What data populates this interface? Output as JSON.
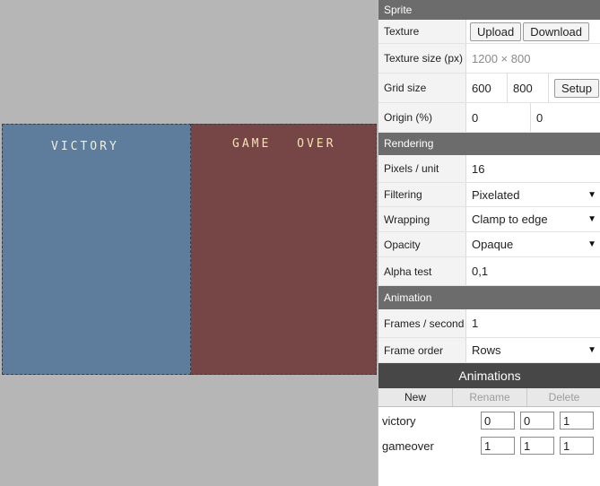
{
  "canvas": {
    "cells": [
      {
        "label": "VICTORY",
        "color": "#5e7c9c"
      },
      {
        "label": "GAME OVER",
        "color": "#764646"
      }
    ]
  },
  "sprite": {
    "header": "Sprite",
    "texture_label": "Texture",
    "upload_label": "Upload",
    "download_label": "Download",
    "texture_size_label": "Texture size (px)",
    "texture_size_value": "1200 × 800",
    "grid_size_label": "Grid size",
    "grid_w": "600",
    "grid_h": "800",
    "setup_label": "Setup",
    "origin_label": "Origin (%)",
    "origin_x": "0",
    "origin_y": "0"
  },
  "rendering": {
    "header": "Rendering",
    "ppu_label": "Pixels / unit",
    "ppu_value": "16",
    "filtering_label": "Filtering",
    "filtering_value": "Pixelated",
    "wrapping_label": "Wrapping",
    "wrapping_value": "Clamp to edge",
    "opacity_label": "Opacity",
    "opacity_value": "Opaque",
    "alpha_label": "Alpha test",
    "alpha_value": "0,1"
  },
  "animation": {
    "header": "Animation",
    "fps_label": "Frames / second",
    "fps_value": "1",
    "order_label": "Frame order",
    "order_value": "Rows"
  },
  "animations": {
    "header": "Animations",
    "new_label": "New",
    "rename_label": "Rename",
    "delete_label": "Delete",
    "items": [
      {
        "name": "victory",
        "a": "0",
        "b": "0",
        "c": "1"
      },
      {
        "name": "gameover",
        "a": "1",
        "b": "1",
        "c": "1"
      }
    ]
  }
}
